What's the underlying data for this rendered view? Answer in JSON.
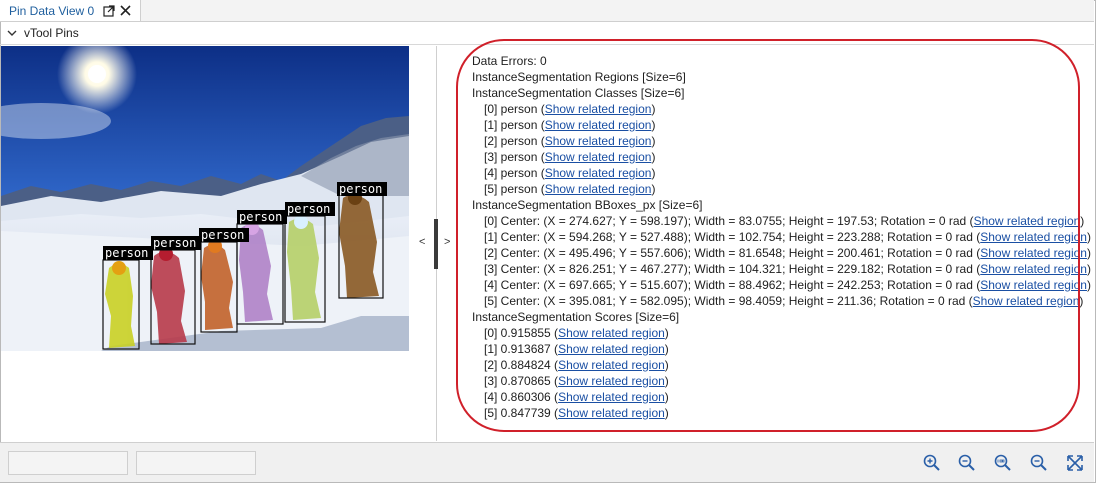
{
  "tab": {
    "title": "Pin Data View 0"
  },
  "section": {
    "title": "vTool Pins"
  },
  "image": {
    "label": "person"
  },
  "splitter": {
    "left_arrow": "<",
    "right_arrow": ">"
  },
  "link_text": "Show related region",
  "data": {
    "errors": "Data Errors: 0",
    "regions": "InstanceSegmentation Regions [Size=6]",
    "classes_header": "InstanceSegmentation Classes [Size=6]",
    "classes": [
      "[0] person (",
      "[1] person (",
      "[2] person (",
      "[3] person (",
      "[4] person (",
      "[5] person ("
    ],
    "bboxes_header": "InstanceSegmentation BBoxes_px [Size=6]",
    "bboxes": [
      "[0] Center: (X = 274.627; Y = 598.197); Width = 83.0755; Height = 197.53; Rotation = 0 rad (",
      "[1] Center: (X = 594.268; Y = 527.488); Width = 102.754; Height = 223.288; Rotation = 0 rad (",
      "[2] Center: (X = 495.496; Y = 557.606); Width = 81.6548; Height = 200.461; Rotation = 0 rad (",
      "[3] Center: (X = 826.251; Y = 467.277); Width = 104.321; Height = 229.182; Rotation = 0 rad (",
      "[4] Center: (X = 697.665; Y = 515.607); Width = 88.4962; Height = 242.253; Rotation = 0 rad (",
      "[5] Center: (X = 395.081; Y = 582.095); Width = 98.4059; Height = 211.36; Rotation = 0 rad ("
    ],
    "scores_header": "InstanceSegmentation Scores [Size=6]",
    "scores": [
      "[0] 0.915855 (",
      "[1] 0.913687 (",
      "[2] 0.884824 (",
      "[3] 0.870865 (",
      "[4] 0.860306 (",
      "[5] 0.847739 ("
    ]
  },
  "colors": {
    "highlight": "#d0202a",
    "link": "#1a4fa3",
    "tab_title": "#1f5f9e",
    "zoom_icon": "#2a5fa8"
  },
  "toolbar": {
    "icons": [
      "zoom-in-icon",
      "zoom-out-icon",
      "zoom-100-icon",
      "zoom-fit-icon",
      "fullscreen-icon"
    ]
  }
}
